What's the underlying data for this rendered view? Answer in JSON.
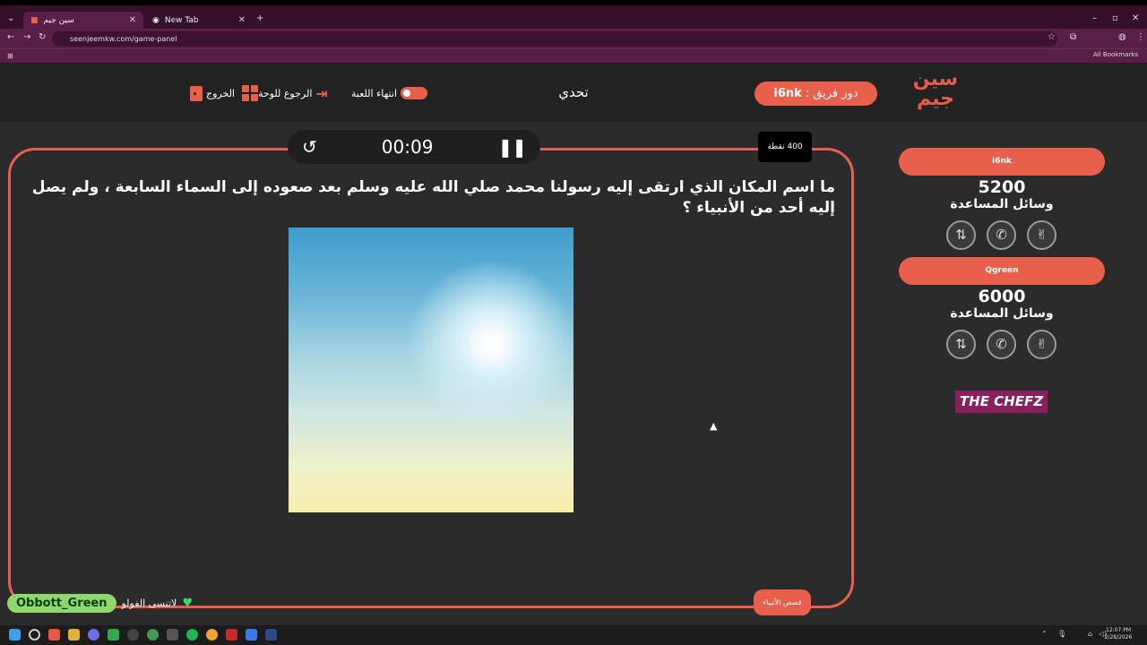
{
  "browser": {
    "tabs": [
      {
        "title": "سين جيم",
        "active": true
      },
      {
        "title": "New Tab",
        "active": false
      }
    ],
    "url": "seenjeemkw.com/game-panel",
    "bookmarks_label": "All Bookmarks"
  },
  "header": {
    "logo_text": [
      "سين",
      "جيم"
    ],
    "turn_label": "دور فريق :",
    "turn_team": "i6nk",
    "mode_title": "تحدي",
    "end_game_label": "انتهاء اللعبة",
    "back_to_board_label": "الرجوع للوحة",
    "exit_label": "الخروج"
  },
  "timer": {
    "time": "00:09",
    "pause_icon": "pause-icon",
    "reset_icon": "history-icon"
  },
  "question": {
    "points": "400 نقطة",
    "text": "ما اسم المكان الذي ارتقى إليه رسولنا محمد صلي الله عليه وسلم بعد صعوده إلى السماء السابعة ، ولم يصل إليه أحد من الأنبياء ؟",
    "category": "قصص الأنبياء"
  },
  "teams": [
    {
      "name": "i6nk",
      "score": "5200",
      "help_title": "وسائل المساعدة"
    },
    {
      "name": "Qgreen",
      "score": "6000",
      "help_title": "وسائل المساعدة"
    }
  ],
  "help_icons": [
    "swap-icon",
    "phone-icon",
    "two-answers-icon"
  ],
  "sponsor": "THE CHEFZ",
  "overlay": {
    "name": "Obbott_Green",
    "message": "لاتنسى الفولو"
  },
  "taskbar": {
    "time": "12:07 PM",
    "date": "2/28/2026"
  },
  "colors": {
    "accent": "#e8604c",
    "background": "#2b2b2b",
    "header": "#222222",
    "browser_frame": "#5a1f48"
  }
}
